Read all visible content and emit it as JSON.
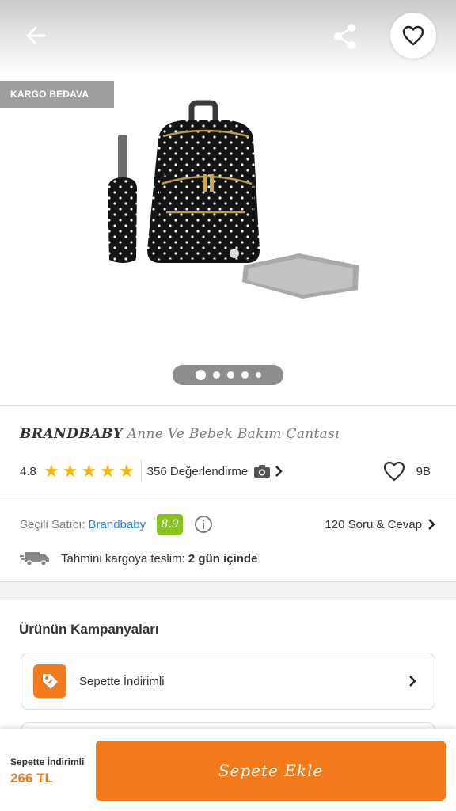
{
  "header": {
    "back_icon": "arrow-left-icon",
    "share_icon": "share-icon",
    "favorite_icon": "heart-outline-icon"
  },
  "gallery": {
    "badge": "KARGO BEDAVA",
    "image_count": 5,
    "active_index": 0
  },
  "product": {
    "brand": "BRANDBABY",
    "title": "Anne Ve Bebek Bakım Çantası",
    "rating": "4.8",
    "stars": 5,
    "review_count": "356 Değerlendirme",
    "like_count": "9B"
  },
  "seller": {
    "label": "Seçili Satıcı:",
    "name": "Brandbaby",
    "score": "8.9",
    "qa_link": "120 Soru & Cevap"
  },
  "delivery": {
    "label": "Tahmini kargoya teslim:",
    "value": "2 gün içinde"
  },
  "campaigns": {
    "title": "Ürünün Kampanyaları",
    "items": [
      {
        "label": "Sepette İndirimli",
        "icon": "tag-icon"
      }
    ]
  },
  "bottom_bar": {
    "price_label": "Sepette İndirimli",
    "price": "266 TL",
    "add_button": "Sepete Ekle"
  },
  "colors": {
    "accent": "#f27a1a",
    "link": "#2f87d6",
    "seller_score_bg": "#8bc41f",
    "star": "#f6b500",
    "badge_bg": "#9e9e9e"
  }
}
